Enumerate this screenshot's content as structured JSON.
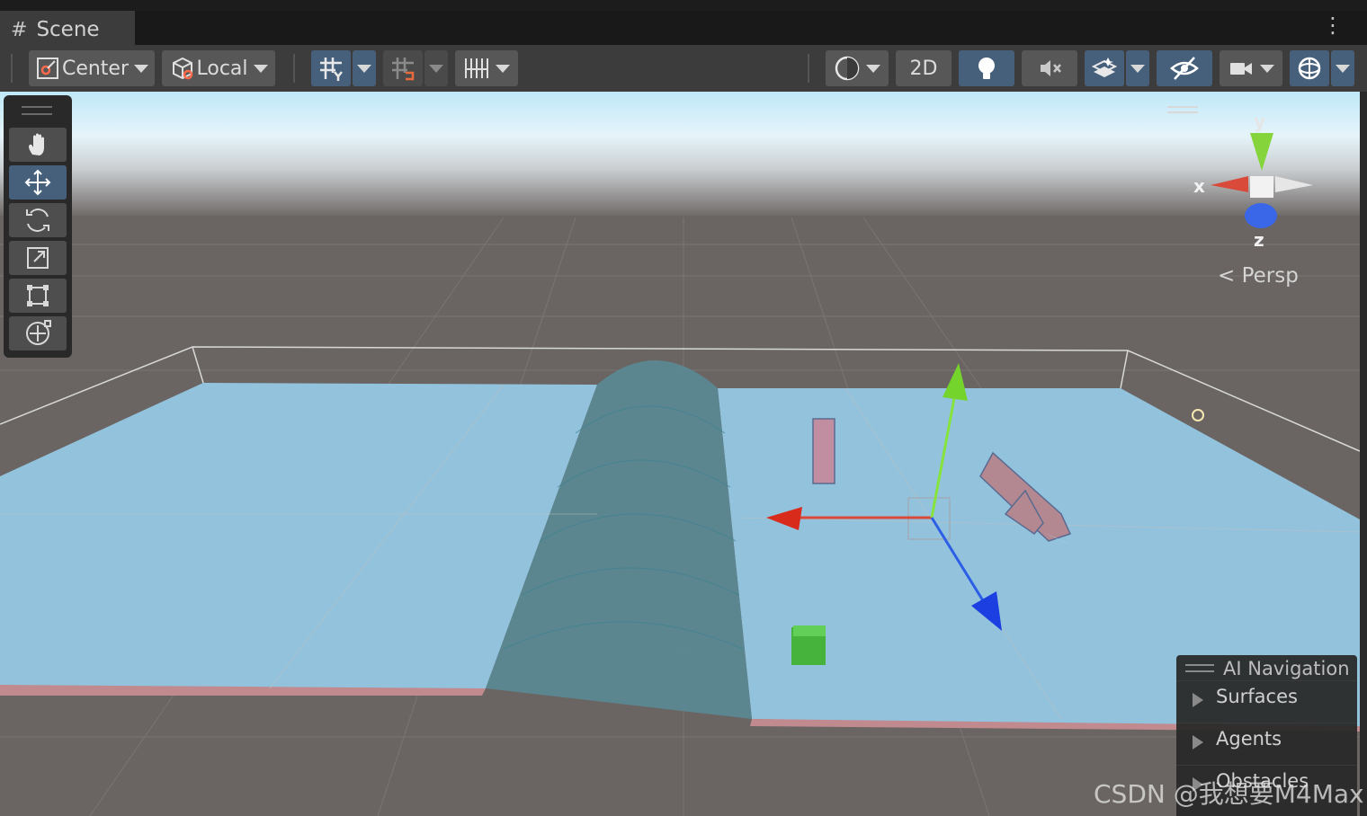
{
  "tab": {
    "title": "Scene"
  },
  "toolbar": {
    "pivot_label": "Center",
    "space_label": "Local",
    "mode_2d_label": "2D"
  },
  "gizmo": {
    "x_label": "x",
    "y_label": "y",
    "z_label": "z",
    "projection_label": "Persp"
  },
  "ai_navigation": {
    "title": "AI Navigation",
    "items": [
      {
        "label": "Surfaces"
      },
      {
        "label": "Agents"
      },
      {
        "label": "Obstacles"
      }
    ]
  },
  "watermark": "CSDN @我想要M4Max",
  "colors": {
    "toolbar_bg": "#3c3c3c",
    "active_button": "#46607c",
    "navmesh_blue": "#93c2dc",
    "ground_gray": "#6a6562",
    "axis_x": "#d94a3a",
    "axis_y": "#86e33c",
    "axis_z": "#2c5fe6"
  },
  "icons": [
    "grid-icon",
    "kebab-icon",
    "pivot-center-icon",
    "local-space-icon",
    "grid-snap-icon",
    "increment-snap-icon",
    "ruler-icon",
    "shading-icon",
    "light-icon",
    "audio-mute-icon",
    "effects-icon",
    "visibility-icon",
    "camera-icon",
    "gizmos-icon",
    "hand-tool-icon",
    "move-tool-icon",
    "rotate-tool-icon",
    "scale-tool-icon",
    "rect-tool-icon",
    "transform-tool-icon"
  ]
}
